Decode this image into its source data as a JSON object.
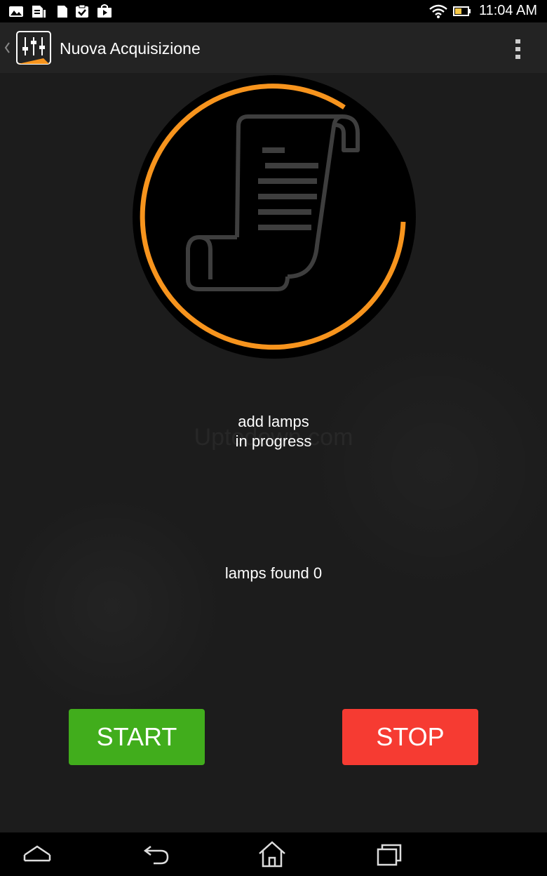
{
  "status_bar": {
    "left_icons": [
      "image-icon",
      "sim-card-icon",
      "sd-card-icon",
      "clipboard-check-icon",
      "play-store-icon"
    ],
    "right_icons": [
      "wifi-icon",
      "battery-icon"
    ],
    "time": "11:04 AM"
  },
  "action_bar": {
    "title": "Nuova Acquisizione",
    "app_icon": "sliders-icon",
    "menu_icon": "overflow-menu-icon"
  },
  "progress": {
    "icon": "scroll-document-icon",
    "accent_color": "#f7941d"
  },
  "status": {
    "line1": "add lamps",
    "line2": "in progress",
    "lamps_found": "lamps found 0"
  },
  "buttons": {
    "start": "START",
    "stop": "STOP",
    "start_color": "#41ad1c",
    "stop_color": "#f63b32"
  },
  "nav_bar": {
    "icons": [
      "collapse-icon",
      "back-icon",
      "home-icon",
      "recents-icon"
    ]
  }
}
